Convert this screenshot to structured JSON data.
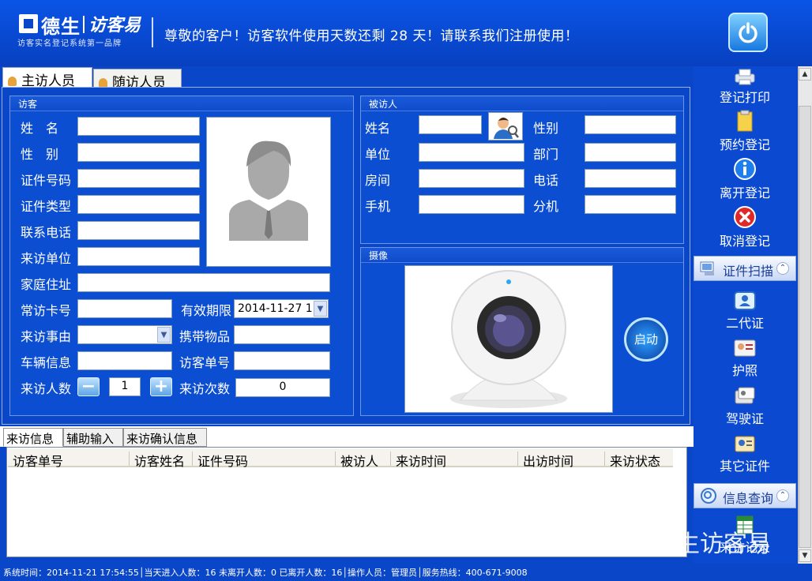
{
  "header": {
    "brand_name": "德生",
    "brand_product": "访客易",
    "brand_tagline": "访客实名登记系统第一品牌",
    "notice": "尊敬的客户！访客软件使用天数还剩 28 天！请联系我们注册使用！"
  },
  "top_tabs": [
    "主访人员",
    "随访人员"
  ],
  "visitor": {
    "group_title": "访客",
    "labels": {
      "name": "姓　名",
      "gender": "性　别",
      "id_number": "证件号码",
      "id_type": "证件类型",
      "phone": "联系电话",
      "company": "来访单位",
      "address": "家庭住址",
      "card_no": "常访卡号",
      "valid_until": "有效期限",
      "reason": "来访事由",
      "items": "携带物品",
      "vehicle": "车辆信息",
      "visit_no": "访客单号",
      "count": "来访人数",
      "visits": "来访次数"
    },
    "valid_until_value": "2014-11-27 1",
    "count_value": "1",
    "visits_value": "0",
    "minus_label": "−",
    "plus_label": "+"
  },
  "host": {
    "group_title": "被访人",
    "labels": {
      "name": "姓名",
      "gender": "性别",
      "dept_unit": "单位",
      "dept": "部门",
      "room": "房间",
      "tel": "电话",
      "mobile": "手机",
      "ext": "分机"
    }
  },
  "camera": {
    "group_title": "摄像",
    "start_label": "启动"
  },
  "bottom_tabs": [
    "来访信息",
    "辅助输入",
    "来访确认信息"
  ],
  "table": {
    "columns": [
      "访客单号",
      "访客姓名",
      "证件号码",
      "被访人",
      "来访时间",
      "出访时间",
      "来访状态"
    ],
    "rows": []
  },
  "status_bar": "系统时间：2014-11-21 17:54:55│当天进入人数：16 未离开人数：0 已离开人数：16│操作人员：管理员│服务热线：400-671-9008",
  "sidebar": {
    "actions": [
      "登记打印",
      "预约登记",
      "离开登记",
      "取消登记"
    ],
    "scan_header": "证件扫描",
    "scan_items": [
      "二代证",
      "护照",
      "驾驶证",
      "其它证件"
    ],
    "query_header": "信息查询",
    "query_items": [
      "来访记录"
    ]
  },
  "watermark": "德生访客易",
  "colors": {
    "background": "#0a46c8",
    "panel": "#0c4ed2",
    "sidebar_header": "#c9d8f4"
  }
}
